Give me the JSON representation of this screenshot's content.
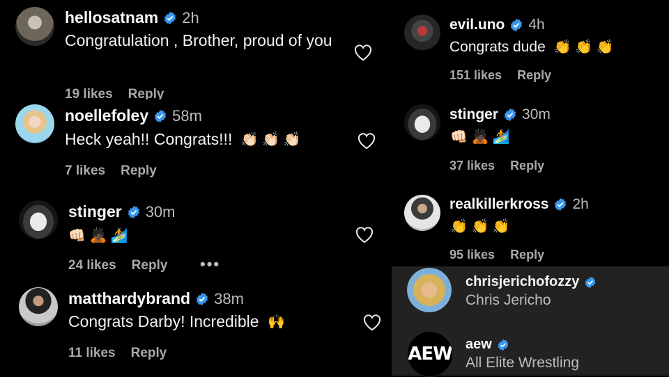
{
  "colors": {
    "background": "#000000",
    "verified": "#3897f0",
    "muted": "#a9a9a9",
    "popup_bg": "#222222"
  },
  "left_column": [
    {
      "username": "hellosatnam",
      "time": "2h",
      "text": "Congratulation , Brother, proud of you",
      "likes": "19 likes",
      "reply": "Reply",
      "emoji": ""
    },
    {
      "username": "noellefoley",
      "time": "58m",
      "text": "Heck yeah!! Congrats!!!",
      "emoji": "👏🏻 👏🏻 👏🏻",
      "likes": "7 likes",
      "reply": "Reply"
    },
    {
      "username": "stinger",
      "time": "30m",
      "text": "",
      "emoji": "👊🏻 🙇🏿 🏄",
      "likes": "24 likes",
      "reply": "Reply",
      "more": "•••"
    },
    {
      "username": "matthardybrand",
      "time": "38m",
      "text": "Congrats Darby! Incredible",
      "emoji": "🙌",
      "likes": "11 likes",
      "reply": "Reply"
    }
  ],
  "right_column": [
    {
      "username": "evil.uno",
      "time": "4h",
      "text": "Congrats dude",
      "emoji": "👏 👏 👏",
      "likes": "151 likes",
      "reply": "Reply"
    },
    {
      "username": "stinger",
      "time": "30m",
      "text": "",
      "emoji": "👊🏻 🙇🏿 🏄",
      "likes": "37 likes",
      "reply": "Reply"
    },
    {
      "username": "realkillerkross",
      "time": "2h",
      "text": "",
      "emoji": "👏 👏 👏",
      "likes": "95 likes",
      "reply": "Reply"
    }
  ],
  "popup": [
    {
      "username": "chrisjerichofozzy",
      "fullname": "Chris Jericho"
    },
    {
      "username": "aew",
      "fullname": "All Elite Wrestling",
      "logo_text": "AEW"
    }
  ]
}
